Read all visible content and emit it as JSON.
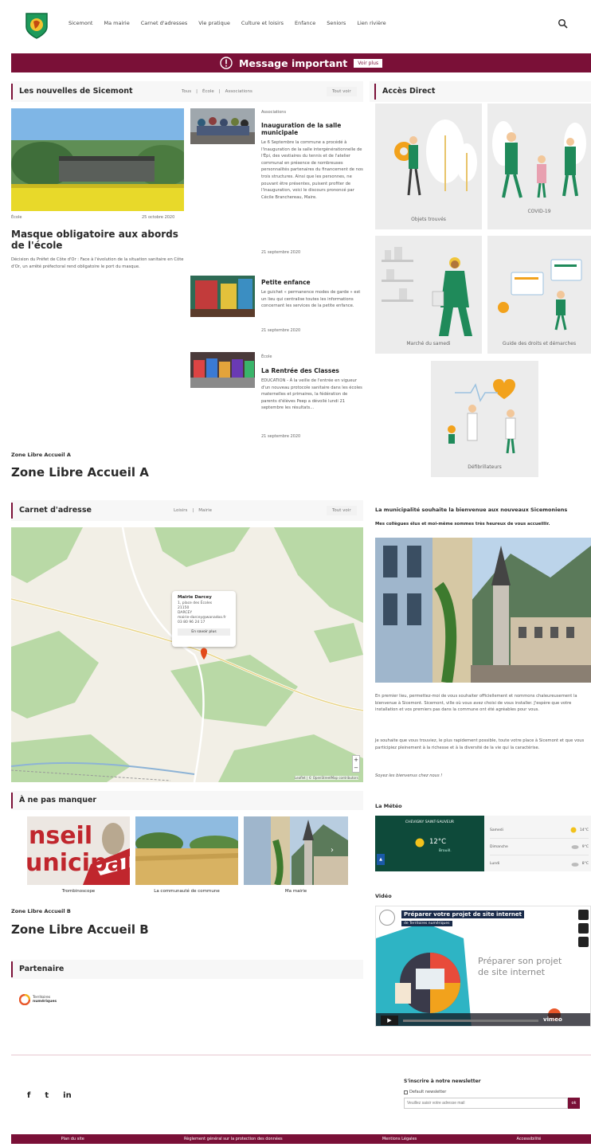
{
  "header": {
    "nav": [
      "Sicemont",
      "Ma mairie",
      "Carnet d'adresses",
      "Vie pratique",
      "Culture et loisirs",
      "Enfance",
      "Seniors",
      "Lien rivière"
    ]
  },
  "alert": {
    "title": "Message important",
    "button": "Voir plus"
  },
  "news": {
    "title": "Les nouvelles de Sicemont",
    "filters": [
      "Tous",
      "École",
      "Associations"
    ],
    "button": "Tout voir",
    "featured": {
      "category": "École",
      "date": "25 octobre 2020",
      "title": "Masque obligatoire aux abords de l'école",
      "summary": "Décision du Préfet de Côte d'Or : Face à l'évolution de la situation sanitaire en Côte d'Or, un arrêté préfectoral rend obligatoire le port du masque."
    },
    "articles": [
      {
        "category": "Associations",
        "title": "Inauguration de la salle municipale",
        "body": "Le 6 Septembre la commune a procédé à l'inauguration de la salle intergénérationnelle de l'Épi, des vestiaires du tennis et de l'atelier communal en présence de nombreuses personnalités partenaires du financement de nos trois structures. Ainsi que les personnes, ne pouvant être présentes, puisent profiter de l'inauguration, voici le discours prononcé par Cécile Branchereau, Maire.",
        "date": "21 septembre 2020"
      },
      {
        "category": "",
        "title": "Petite enfance",
        "body": "Le guichet « permanence modes de garde » est un lieu qui centralise toutes les informations concernant les services de la petite enfance.",
        "date": "21 septembre 2020"
      },
      {
        "category": "École",
        "title": "La Rentrée des Classes",
        "body": "EDUCATION - À la veille de l'entrée en vigueur d'un nouveau protocole sanitaire dans les écoles maternelles et primaires, la fédération de parents d'élèves Peep a dévoilé lundi 21 septembre les résultats...",
        "date": "21 septembre 2020"
      }
    ]
  },
  "access": {
    "title": "Accès Direct",
    "tiles": [
      "Objets trouvés",
      "COVID-19",
      "Marché du samedi",
      "Guide des droits et démarches",
      "Défibrillateurs"
    ]
  },
  "zone_a": {
    "small": "Zone Libre Accueil A",
    "big": "Zone Libre Accueil A"
  },
  "address": {
    "title": "Carnet d'adresse",
    "filters": [
      "Loisirs",
      "Mairie"
    ],
    "button": "Tout voir",
    "popup": {
      "name": "Mairie Darcey",
      "lines": [
        "1, place des Écoles",
        "21150",
        "DARCEY",
        "mairie-darcey@wanadoo.fr",
        "03 80 96 24 17"
      ],
      "button": "En savoir plus"
    },
    "attribution": "Leaflet | © OpenStreetMap contributors"
  },
  "welcome": {
    "title": "La municipalité souhaite la bienvenue aux nouveaux Sicemoniens",
    "subtitle": "Mes collègues élus et moi-même sommes très heureux de vous accueillir.",
    "p1": "En premier lieu, permettez-moi de vous souhaiter officiellement et nommons chaleureusement la bienvenue à Sicemont. Sicemont, ville où vous avez choisi de vous installer. J'espère que votre installation et vos premiers pas dans la commune ont été agréables pour vous.",
    "p2": "Je souhaite que vous trouviez, le plus rapidement possible, toute votre place à Sicemont et que vous participiez pleinement à la richesse et à la diversité de la vie qui la caractérise.",
    "p3": "Soyez les bienvenus chez nous !"
  },
  "dont_miss": {
    "title": "À ne pas manquer",
    "items": [
      "Trombinoscope",
      "La communauté de commune",
      "Ma mairie"
    ],
    "banner_text_1": "nseil",
    "banner_text_2": "unicipal"
  },
  "zone_b": {
    "small": "Zone Libre Accueil B",
    "big": "Zone Libre Accueil B"
  },
  "partner": {
    "title": "Partenaire",
    "logo_line1": "Territoires",
    "logo_line2": "numériques"
  },
  "weather": {
    "title": "La Météo",
    "city": "CHEVIGNY SAINT-SAUVEUR",
    "temp": "12°C",
    "cond": "Brouill.",
    "rows": [
      {
        "day": "Samedi",
        "temp": "14°C"
      },
      {
        "day": "Dimanche",
        "temp": "9°C"
      },
      {
        "day": "Lundi",
        "temp": "8°C"
      }
    ]
  },
  "video": {
    "title": "Vidéo",
    "video_title": "Préparer votre projet de site internet",
    "video_sub": "de Territoires numériques",
    "slide_text_1": "Préparer son projet",
    "slide_text_2": "de site internet",
    "brand": "vimeo"
  },
  "newsletter": {
    "title": "S'inscrire à notre newsletter",
    "checkbox": "Default newsletter",
    "placeholder": "Veuillez saisir votre adresse mail",
    "button": "ok"
  },
  "social": [
    "f",
    "t",
    "in"
  ],
  "footer": [
    "Plan du site",
    "Règlement général sur la protection des données",
    "Mentions Légales",
    "Accessibilité"
  ],
  "colors": {
    "accent": "#7a1037",
    "green": "#1f8a5a"
  }
}
